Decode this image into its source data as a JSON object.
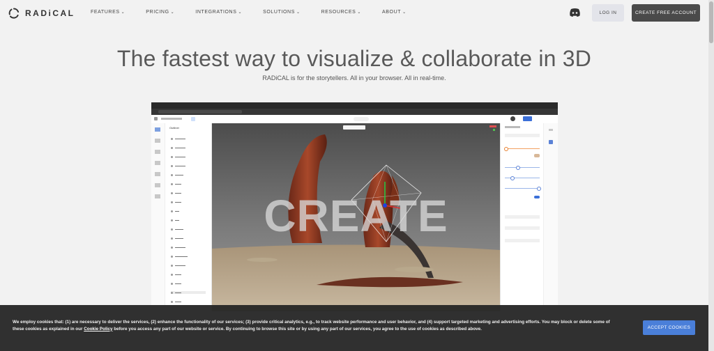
{
  "brand": {
    "name": "RADiCAL"
  },
  "nav": {
    "items": [
      {
        "label": "FEATURES"
      },
      {
        "label": "PRICING"
      },
      {
        "label": "INTEGRATIONS"
      },
      {
        "label": "SOLUTIONS"
      },
      {
        "label": "RESOURCES"
      },
      {
        "label": "ABOUT"
      }
    ],
    "login_label": "LOG IN",
    "create_label": "CREATE FREE ACCOUNT",
    "discord_icon": "discord-icon"
  },
  "hero": {
    "title": "The fastest way to visualize & collaborate in 3D",
    "subtitle": "RADiCAL is for the storytellers. All in your browser. All in real-time."
  },
  "app_preview": {
    "outline_title": "Outliner",
    "overlay_word": "CREATE"
  },
  "cookie": {
    "text_before": "We employ cookies that: (1) are necessary to deliver the services, (2) enhance the functionality of our services; (3) provide critical analytics, e.g., to track website performance and user behavior, and (4) support targeted marketing and advertising efforts. You may block or delete some of these cookies as explained in our ",
    "policy_link": "Cookie Policy",
    "text_after": " before you access any part of our website or service. By continuing to browse this site or by using any part of our services, you agree to the use of cookies as described above.",
    "accept_label": "ACCEPT COOKIES"
  },
  "colors": {
    "accent": "#4a7fd9",
    "dark_button": "#4a4a4a"
  }
}
